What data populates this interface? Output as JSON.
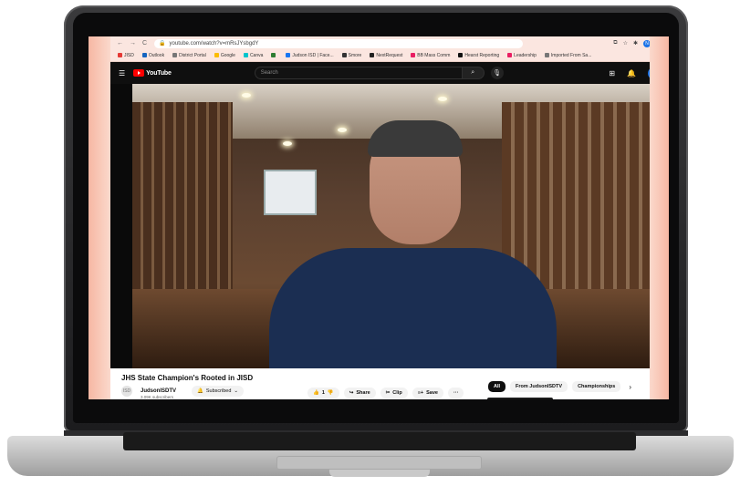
{
  "browser": {
    "url": "youtube.com/watch?v=mRsJYsbgdY",
    "bookmarks": [
      {
        "label": "JISD",
        "color": "#e53935"
      },
      {
        "label": "Outlook",
        "color": "#1565c0"
      },
      {
        "label": "District Portal",
        "color": "#777777"
      },
      {
        "label": "Google",
        "color": "#fbbc04"
      },
      {
        "label": "Canva",
        "color": "#00c4cc"
      },
      {
        "label": "",
        "color": "#2e7d32"
      },
      {
        "label": "Judson ISD | Face...",
        "color": "#1877f2"
      },
      {
        "label": "Smore",
        "color": "#333333"
      },
      {
        "label": "NextRequest",
        "color": "#222222"
      },
      {
        "label": "BB Mass Comm",
        "color": "#e91e63"
      },
      {
        "label": "Hearst Reporting",
        "color": "#111111"
      },
      {
        "label": "Leadership",
        "color": "#e91e63"
      },
      {
        "label": "Imported From Sa...",
        "color": "#777777"
      }
    ],
    "profile_initial": "N"
  },
  "youtube": {
    "logo_text": "YouTube",
    "search_placeholder": "Search",
    "avatar_initial": "N"
  },
  "video": {
    "title": "JHS State Champion's Rooted in JISD",
    "channel_name": "JudsonISDTV",
    "channel_subs": "3.09K subscribers",
    "subscribe_label": "Subscribed",
    "like_count": "1",
    "share_label": "Share",
    "clip_label": "Clip",
    "save_label": "Save",
    "more_label": "···"
  },
  "chips": [
    {
      "label": "All",
      "active": true
    },
    {
      "label": "From JudsonISDTV",
      "active": false
    },
    {
      "label": "Championships",
      "active": false
    }
  ],
  "colors": {
    "yt_red": "#ff0000",
    "dark": "#0f0f0f",
    "accent_blue": "#1a73e8"
  }
}
